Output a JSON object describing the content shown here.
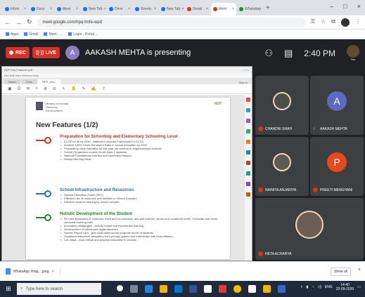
{
  "browser": {
    "tabs": [
      {
        "label": "Inbox",
        "fav": "blue"
      },
      {
        "label": "Docs",
        "fav": "blue"
      },
      {
        "label": "Meet",
        "fav": "blue"
      },
      {
        "label": "New Tab",
        "fav": "blue"
      },
      {
        "label": "Drive",
        "fav": "blue"
      },
      {
        "label": "Sheets",
        "fav": "blue"
      },
      {
        "label": "New Tab",
        "fav": "blue"
      },
      {
        "label": "Gmail",
        "fav": "red"
      },
      {
        "label": "Meet",
        "fav": "red",
        "active": true
      },
      {
        "label": "WhatsApp",
        "fav": "green"
      }
    ],
    "new_tab": "+",
    "window_controls": [
      "–",
      "□",
      "×"
    ],
    "url": "meet.google.com/hpq-tmfe-wpd",
    "bookmarks": [
      "Apps",
      "Gmail",
      "Meet - ...",
      "Login - Portal ..."
    ]
  },
  "meet": {
    "rec_label": "REC",
    "live_label": "LIVE",
    "presenter_initial": "A",
    "presenter_text": "AAKASH MEHTA is presenting",
    "time": "2:40 PM",
    "you_label": "You",
    "participants": [
      {
        "name": "CHANDNI SHAH",
        "muted": true,
        "kind": "photo"
      },
      {
        "name": "AAKASH MEHTA",
        "muted": false,
        "kind": "avatar",
        "initial": "A",
        "color": "#5c6bc0"
      },
      {
        "name": "NAINITA ANJARIYA",
        "muted": true,
        "kind": "photo"
      },
      {
        "name": "PREETI MENGHANI",
        "muted": true,
        "kind": "avatar",
        "initial": "P",
        "color": "#e64a19"
      },
      {
        "name": "HETA ACHARYA",
        "muted": true,
        "kind": "photo"
      }
    ]
  },
  "shared_doc": {
    "window_title": "NEP Key Features.pdf",
    "tab_labels": [
      "Home",
      "Tools",
      "NEP_Key..."
    ],
    "zoom": "Sign in",
    "logo_text": "Ministry of Human Resource Development",
    "right_logo": "NEP",
    "title": "New Features (1/2)",
    "sections": [
      {
        "heading": "Preparation for Schooling and Elementary Schooling Level",
        "color": "#c0392b",
        "bullets": [
          "ECCE for all by 2030 - National Curricular Framework for ECCE",
          "Achieve 100% Gross Enrolment Ratio in school education by 2030",
          "Preparatory class Balvatika for five year old children in anganwadi/pre-schools",
          "School Preparation module for all class 1 students",
          "National Foundational Literacy and Numeracy Mission",
          "Delays Mid-Day Meal"
        ]
      },
      {
        "heading": "School Infrastructure and Resources",
        "color": "#2471a3",
        "bullets": [
          "Special Education Zones (SEZ)",
          "Effective use of resources and facilities in School Complex",
          "Efficient resource sharing by school complex"
        ]
      },
      {
        "heading": "Holistic Development of the Student",
        "color": "#2e7d32",
        "bullets": [
          "No hard separation of curricular, extra and co-curricular, arts and science, sports and vocational crafts. Curricular and extra-curricular learning both",
          "Innovative pedagogies - Activity-based and experiential learning",
          "Development of critical and digital literacies",
          "Holistic Report card - give multi-dimensional progress report of students",
          "Vocational education integration from primary grades and internships with local artisans",
          "Lok Vidya - local ethical and practical education in schools"
        ]
      }
    ]
  },
  "downloads": {
    "file_name": "WhatsApp Imag....jpeg",
    "show_all": "Show all",
    "close": "×"
  },
  "taskbar": {
    "search_placeholder": "Type here to search",
    "time": "14:40",
    "date": "22-09-2020",
    "lang": "ENG"
  }
}
